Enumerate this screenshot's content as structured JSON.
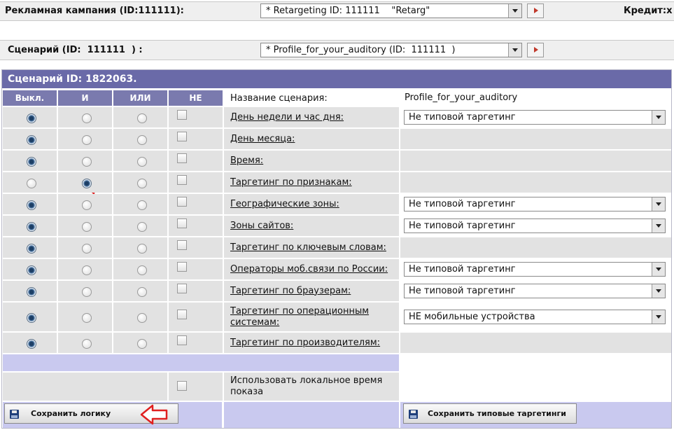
{
  "campaign": {
    "label": "Рекламная кампания (ID:111111):",
    "selected": "* Retargeting ID: 111111    \"Retarg\"",
    "credit_label": "Кредит:х"
  },
  "scenario_bar": {
    "label": "Сценарий (ID:  111111  ) :",
    "selected": "* Profile_for_your_auditory (ID:  111111  )"
  },
  "panel": {
    "title": "Сценарий ID: 1822063.",
    "columns": [
      "Выкл.",
      "И",
      "ИЛИ",
      "НЕ"
    ],
    "name_label": "Название сценария:",
    "name_value": "Profile_for_your_auditory",
    "rows": [
      {
        "label": "День недели и час дня:",
        "mode": "off",
        "select": "Не типовой таргетинг"
      },
      {
        "label": "День месяца:",
        "mode": "off",
        "select": ""
      },
      {
        "label": "Время:",
        "mode": "off",
        "select": ""
      },
      {
        "label": "Таргетинг по признакам:",
        "mode": "and",
        "select": ""
      },
      {
        "label": "Географические зоны:",
        "mode": "off",
        "select": "Не типовой таргетинг"
      },
      {
        "label": "Зоны сайтов:",
        "mode": "off",
        "select": "Не типовой таргетинг"
      },
      {
        "label": "Таргетинг по ключевым словам:",
        "mode": "off",
        "select": ""
      },
      {
        "label": "Операторы моб.связи по России:",
        "mode": "off",
        "select": "Не типовой таргетинг"
      },
      {
        "label": "Таргетинг по браузерам:",
        "mode": "off",
        "select": "Не типовой таргетинг"
      },
      {
        "label": "Таргетинг по операционным системам:",
        "mode": "off",
        "select": "НЕ мобильные устройства"
      },
      {
        "label": "Таргетинг по производителям:",
        "mode": "off",
        "select": ""
      }
    ],
    "local_time_label": "Использовать локальное время показа",
    "save_logic_label": "Сохранить логику",
    "save_typical_label": "Сохранить типовые таргетинги"
  },
  "colors": {
    "header_bg": "#6a6aa8",
    "column_header_bg": "#7a7aae",
    "lavender_bg": "#c9c9ef",
    "arrow_red": "#e02020"
  }
}
